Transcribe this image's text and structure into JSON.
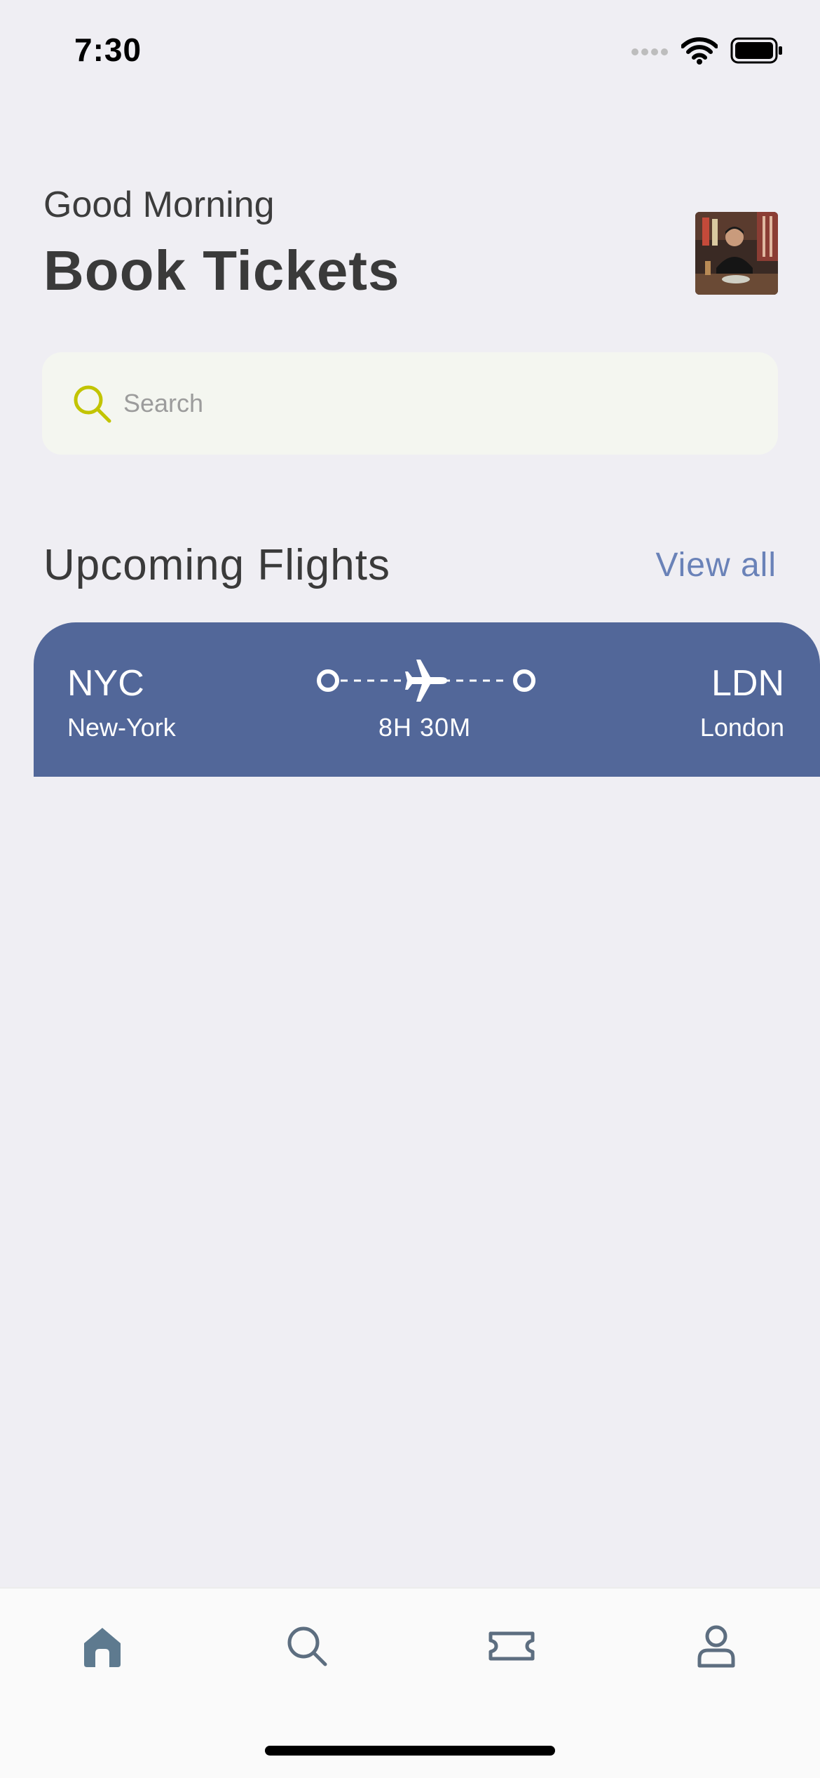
{
  "status_bar": {
    "time": "7:30"
  },
  "header": {
    "greeting": "Good Morning",
    "title": "Book Tickets"
  },
  "search": {
    "placeholder": "Search"
  },
  "upcoming": {
    "section_title": "Upcoming Flights",
    "view_all_label": "View all"
  },
  "flight": {
    "from_code": "NYC",
    "from_city": "New-York",
    "to_code": "LDN",
    "to_city": "London",
    "duration": "8H 30M"
  },
  "nav": {
    "items": [
      "home-icon",
      "search-icon",
      "ticket-icon",
      "profile-icon"
    ],
    "active_index": 0
  },
  "colors": {
    "background": "#efeef3",
    "card": "#526799",
    "accent_link": "#6a82b8",
    "search_icon": "#c2c400",
    "nav_active": "#5e7a8f",
    "nav_inactive": "#5d6e80"
  }
}
